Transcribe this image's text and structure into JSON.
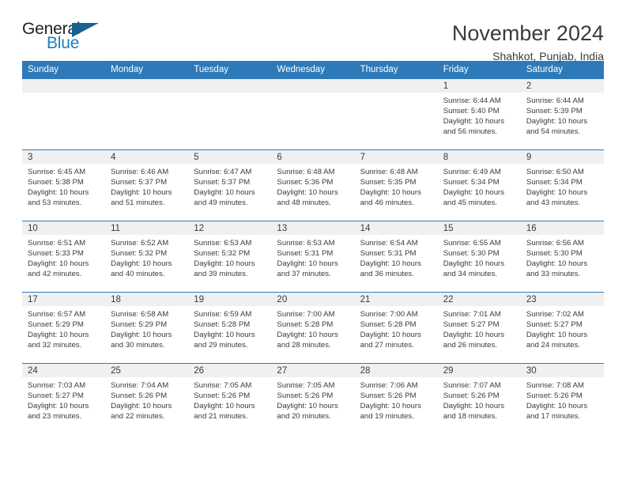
{
  "logo": {
    "word_one": "General",
    "word_two": "Blue",
    "triangle_icon": "logo-triangle-icon",
    "brand_color": "#1f7bc1",
    "triangle_color": "#18628f"
  },
  "header": {
    "title": "November 2024",
    "subtitle": "Shahkot, Punjab, India",
    "accent_color": "#2e7ab8",
    "band_color": "#f0f0f0",
    "text_color": "#3b3b3b"
  },
  "calendar": {
    "weekday_headers": [
      "Sunday",
      "Monday",
      "Tuesday",
      "Wednesday",
      "Thursday",
      "Friday",
      "Saturday"
    ],
    "weeks": [
      [
        {
          "day": "",
          "empty": true,
          "sunrise": "",
          "sunset": "",
          "daylight_line1": "",
          "daylight_line2": ""
        },
        {
          "day": "",
          "empty": true,
          "sunrise": "",
          "sunset": "",
          "daylight_line1": "",
          "daylight_line2": ""
        },
        {
          "day": "",
          "empty": true,
          "sunrise": "",
          "sunset": "",
          "daylight_line1": "",
          "daylight_line2": ""
        },
        {
          "day": "",
          "empty": true,
          "sunrise": "",
          "sunset": "",
          "daylight_line1": "",
          "daylight_line2": ""
        },
        {
          "day": "",
          "empty": true,
          "sunrise": "",
          "sunset": "",
          "daylight_line1": "",
          "daylight_line2": ""
        },
        {
          "day": "1",
          "empty": false,
          "sunrise": "Sunrise: 6:44 AM",
          "sunset": "Sunset: 5:40 PM",
          "daylight_line1": "Daylight: 10 hours",
          "daylight_line2": "and 56 minutes."
        },
        {
          "day": "2",
          "empty": false,
          "sunrise": "Sunrise: 6:44 AM",
          "sunset": "Sunset: 5:39 PM",
          "daylight_line1": "Daylight: 10 hours",
          "daylight_line2": "and 54 minutes."
        }
      ],
      [
        {
          "day": "3",
          "empty": false,
          "sunrise": "Sunrise: 6:45 AM",
          "sunset": "Sunset: 5:38 PM",
          "daylight_line1": "Daylight: 10 hours",
          "daylight_line2": "and 53 minutes."
        },
        {
          "day": "4",
          "empty": false,
          "sunrise": "Sunrise: 6:46 AM",
          "sunset": "Sunset: 5:37 PM",
          "daylight_line1": "Daylight: 10 hours",
          "daylight_line2": "and 51 minutes."
        },
        {
          "day": "5",
          "empty": false,
          "sunrise": "Sunrise: 6:47 AM",
          "sunset": "Sunset: 5:37 PM",
          "daylight_line1": "Daylight: 10 hours",
          "daylight_line2": "and 49 minutes."
        },
        {
          "day": "6",
          "empty": false,
          "sunrise": "Sunrise: 6:48 AM",
          "sunset": "Sunset: 5:36 PM",
          "daylight_line1": "Daylight: 10 hours",
          "daylight_line2": "and 48 minutes."
        },
        {
          "day": "7",
          "empty": false,
          "sunrise": "Sunrise: 6:48 AM",
          "sunset": "Sunset: 5:35 PM",
          "daylight_line1": "Daylight: 10 hours",
          "daylight_line2": "and 46 minutes."
        },
        {
          "day": "8",
          "empty": false,
          "sunrise": "Sunrise: 6:49 AM",
          "sunset": "Sunset: 5:34 PM",
          "daylight_line1": "Daylight: 10 hours",
          "daylight_line2": "and 45 minutes."
        },
        {
          "day": "9",
          "empty": false,
          "sunrise": "Sunrise: 6:50 AM",
          "sunset": "Sunset: 5:34 PM",
          "daylight_line1": "Daylight: 10 hours",
          "daylight_line2": "and 43 minutes."
        }
      ],
      [
        {
          "day": "10",
          "empty": false,
          "sunrise": "Sunrise: 6:51 AM",
          "sunset": "Sunset: 5:33 PM",
          "daylight_line1": "Daylight: 10 hours",
          "daylight_line2": "and 42 minutes."
        },
        {
          "day": "11",
          "empty": false,
          "sunrise": "Sunrise: 6:52 AM",
          "sunset": "Sunset: 5:32 PM",
          "daylight_line1": "Daylight: 10 hours",
          "daylight_line2": "and 40 minutes."
        },
        {
          "day": "12",
          "empty": false,
          "sunrise": "Sunrise: 6:53 AM",
          "sunset": "Sunset: 5:32 PM",
          "daylight_line1": "Daylight: 10 hours",
          "daylight_line2": "and 39 minutes."
        },
        {
          "day": "13",
          "empty": false,
          "sunrise": "Sunrise: 6:53 AM",
          "sunset": "Sunset: 5:31 PM",
          "daylight_line1": "Daylight: 10 hours",
          "daylight_line2": "and 37 minutes."
        },
        {
          "day": "14",
          "empty": false,
          "sunrise": "Sunrise: 6:54 AM",
          "sunset": "Sunset: 5:31 PM",
          "daylight_line1": "Daylight: 10 hours",
          "daylight_line2": "and 36 minutes."
        },
        {
          "day": "15",
          "empty": false,
          "sunrise": "Sunrise: 6:55 AM",
          "sunset": "Sunset: 5:30 PM",
          "daylight_line1": "Daylight: 10 hours",
          "daylight_line2": "and 34 minutes."
        },
        {
          "day": "16",
          "empty": false,
          "sunrise": "Sunrise: 6:56 AM",
          "sunset": "Sunset: 5:30 PM",
          "daylight_line1": "Daylight: 10 hours",
          "daylight_line2": "and 33 minutes."
        }
      ],
      [
        {
          "day": "17",
          "empty": false,
          "sunrise": "Sunrise: 6:57 AM",
          "sunset": "Sunset: 5:29 PM",
          "daylight_line1": "Daylight: 10 hours",
          "daylight_line2": "and 32 minutes."
        },
        {
          "day": "18",
          "empty": false,
          "sunrise": "Sunrise: 6:58 AM",
          "sunset": "Sunset: 5:29 PM",
          "daylight_line1": "Daylight: 10 hours",
          "daylight_line2": "and 30 minutes."
        },
        {
          "day": "19",
          "empty": false,
          "sunrise": "Sunrise: 6:59 AM",
          "sunset": "Sunset: 5:28 PM",
          "daylight_line1": "Daylight: 10 hours",
          "daylight_line2": "and 29 minutes."
        },
        {
          "day": "20",
          "empty": false,
          "sunrise": "Sunrise: 7:00 AM",
          "sunset": "Sunset: 5:28 PM",
          "daylight_line1": "Daylight: 10 hours",
          "daylight_line2": "and 28 minutes."
        },
        {
          "day": "21",
          "empty": false,
          "sunrise": "Sunrise: 7:00 AM",
          "sunset": "Sunset: 5:28 PM",
          "daylight_line1": "Daylight: 10 hours",
          "daylight_line2": "and 27 minutes."
        },
        {
          "day": "22",
          "empty": false,
          "sunrise": "Sunrise: 7:01 AM",
          "sunset": "Sunset: 5:27 PM",
          "daylight_line1": "Daylight: 10 hours",
          "daylight_line2": "and 26 minutes."
        },
        {
          "day": "23",
          "empty": false,
          "sunrise": "Sunrise: 7:02 AM",
          "sunset": "Sunset: 5:27 PM",
          "daylight_line1": "Daylight: 10 hours",
          "daylight_line2": "and 24 minutes."
        }
      ],
      [
        {
          "day": "24",
          "empty": false,
          "sunrise": "Sunrise: 7:03 AM",
          "sunset": "Sunset: 5:27 PM",
          "daylight_line1": "Daylight: 10 hours",
          "daylight_line2": "and 23 minutes."
        },
        {
          "day": "25",
          "empty": false,
          "sunrise": "Sunrise: 7:04 AM",
          "sunset": "Sunset: 5:26 PM",
          "daylight_line1": "Daylight: 10 hours",
          "daylight_line2": "and 22 minutes."
        },
        {
          "day": "26",
          "empty": false,
          "sunrise": "Sunrise: 7:05 AM",
          "sunset": "Sunset: 5:26 PM",
          "daylight_line1": "Daylight: 10 hours",
          "daylight_line2": "and 21 minutes."
        },
        {
          "day": "27",
          "empty": false,
          "sunrise": "Sunrise: 7:05 AM",
          "sunset": "Sunset: 5:26 PM",
          "daylight_line1": "Daylight: 10 hours",
          "daylight_line2": "and 20 minutes."
        },
        {
          "day": "28",
          "empty": false,
          "sunrise": "Sunrise: 7:06 AM",
          "sunset": "Sunset: 5:26 PM",
          "daylight_line1": "Daylight: 10 hours",
          "daylight_line2": "and 19 minutes."
        },
        {
          "day": "29",
          "empty": false,
          "sunrise": "Sunrise: 7:07 AM",
          "sunset": "Sunset: 5:26 PM",
          "daylight_line1": "Daylight: 10 hours",
          "daylight_line2": "and 18 minutes."
        },
        {
          "day": "30",
          "empty": false,
          "sunrise": "Sunrise: 7:08 AM",
          "sunset": "Sunset: 5:26 PM",
          "daylight_line1": "Daylight: 10 hours",
          "daylight_line2": "and 17 minutes."
        }
      ]
    ]
  }
}
